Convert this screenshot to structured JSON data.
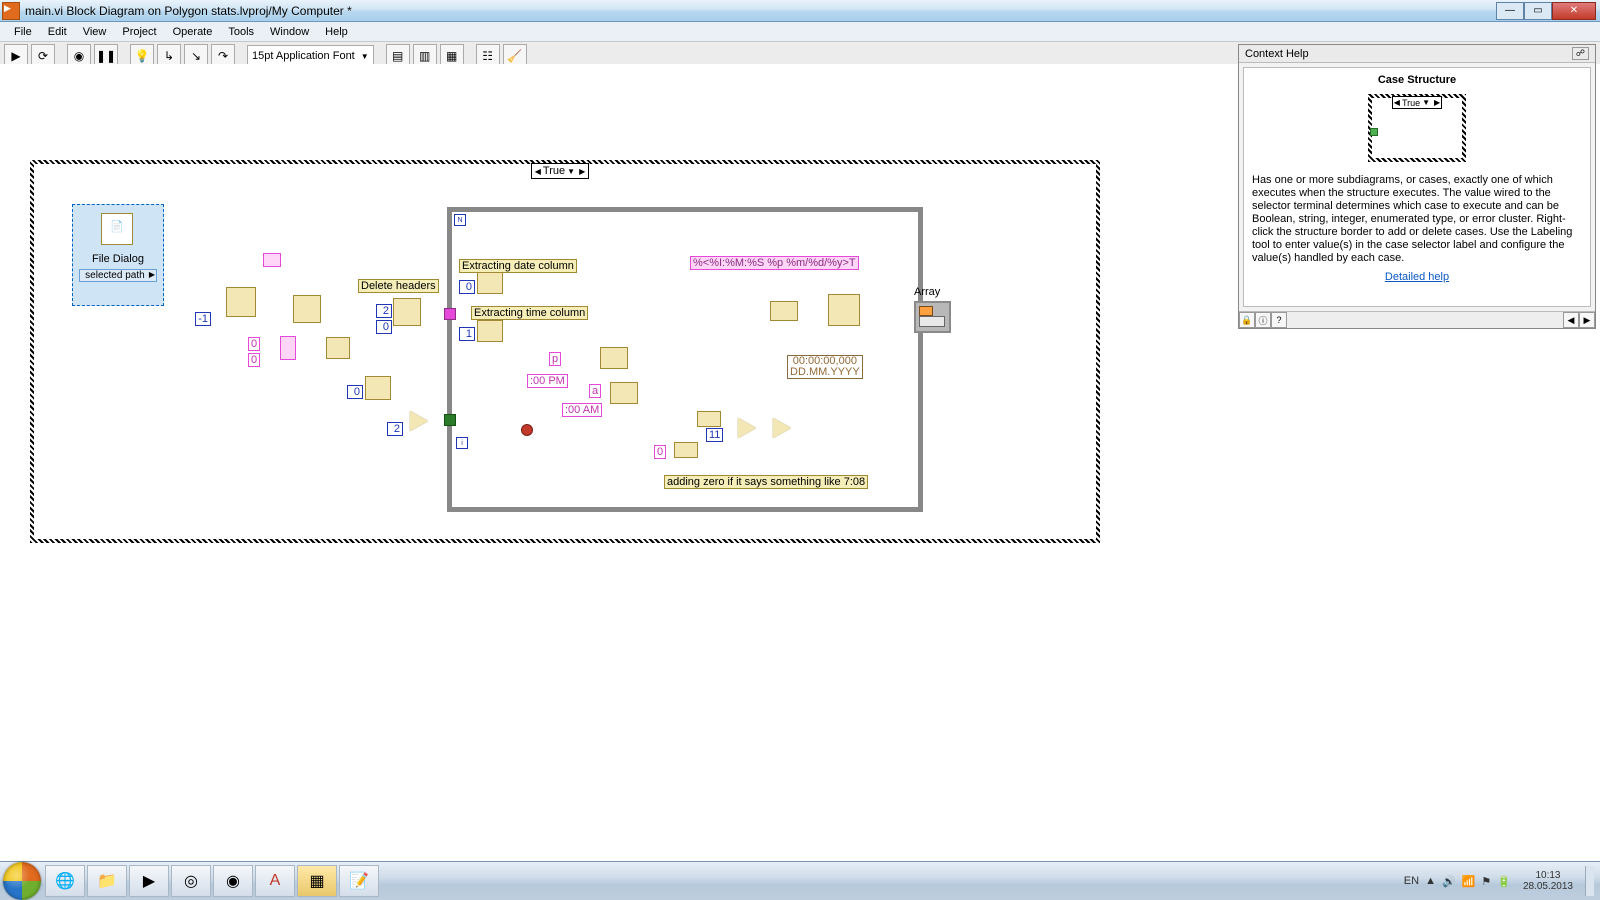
{
  "window": {
    "title": "main.vi Block Diagram on Polygon stats.lvproj/My Computer *"
  },
  "menus": [
    "File",
    "Edit",
    "View",
    "Project",
    "Operate",
    "Tools",
    "Window",
    "Help"
  ],
  "toolbar": {
    "font": "15pt Application Font"
  },
  "diagram": {
    "case_selector": "True",
    "file_dialog_title": "File Dialog",
    "file_dialog_path": "selected path",
    "labels": {
      "delete_headers": "Delete headers",
      "extract_date": "Extracting date column",
      "extract_time": "Extracting time column",
      "time_fmt": "%<%I:%M:%S %p %m/%d/%y>T",
      "datetime_const_l1": "00:00:00,000",
      "datetime_const_l2": "DD.MM.YYYY",
      "add_zero": "adding zero if it says something like 7:08",
      "array_ind": "Array"
    },
    "str_consts": {
      "p": "p",
      "pm": ":00 PM",
      "a": "a",
      "am": ":00 AM",
      "zero": "0"
    },
    "num_consts": {
      "neg1": "-1",
      "zeroA": "0",
      "zeroB": "0",
      "twoA": "2",
      "zeroC": "0",
      "zeroD": "0",
      "twoB": "2",
      "zeroE": "0",
      "oneA": "1",
      "eleven": "11"
    }
  },
  "context_help": {
    "panel_title": "Context Help",
    "topic": "Case Structure",
    "mini_sel": "True",
    "body": "Has one or more subdiagrams, or cases, exactly one of which executes when the structure executes. The value wired to the selector terminal determines which case to execute and can be Boolean, string, integer, enumerated type, or error cluster. Right-click the structure border to add or delete cases. Use the Labeling tool to enter value(s) in the case selector label and configure the value(s) handled by each case.",
    "link": "Detailed help"
  },
  "project_tab": "Polygon stats.lvproj/My Computer",
  "tray": {
    "lang": "EN",
    "time": "10:13",
    "date": "28.05.2013"
  }
}
